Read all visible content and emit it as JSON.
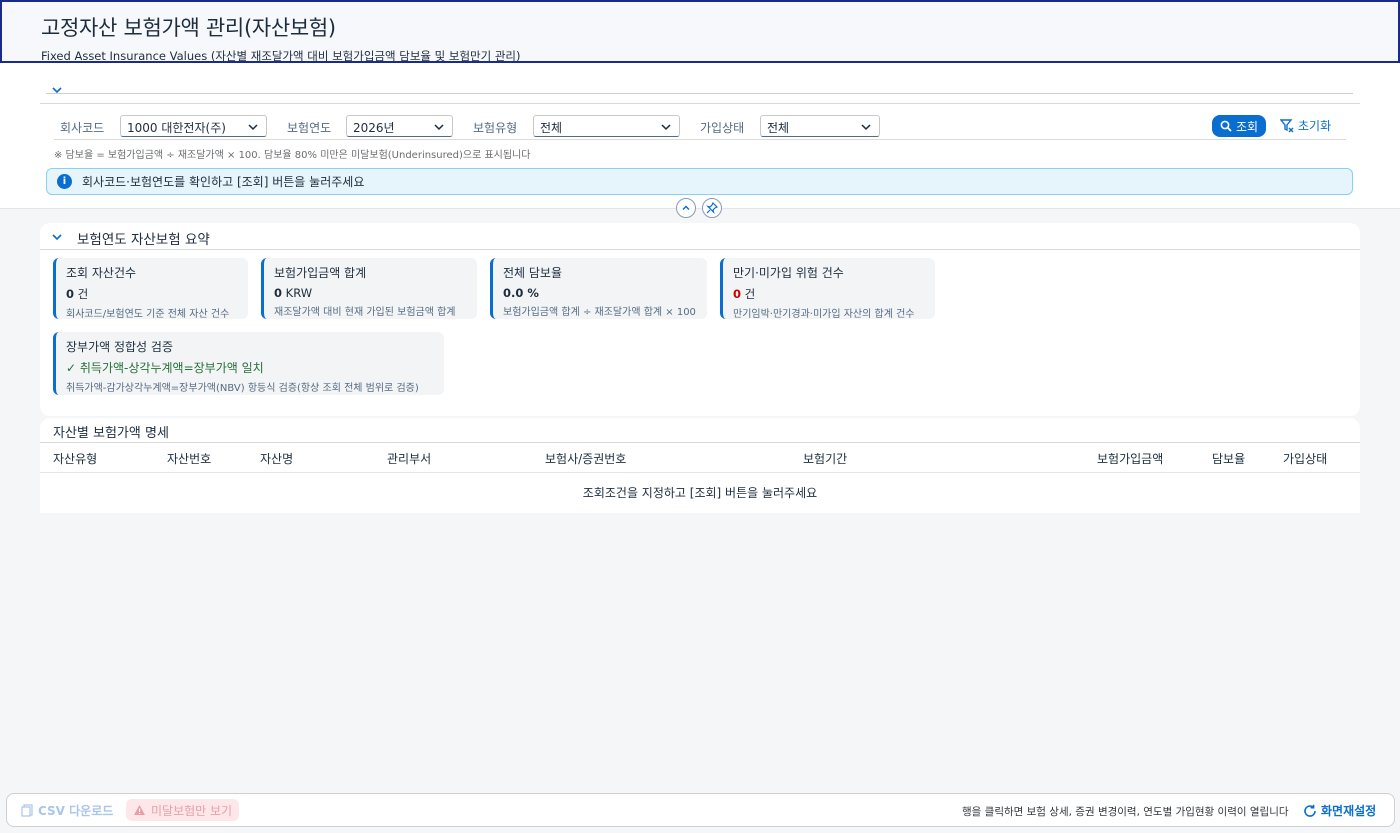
{
  "header": {
    "title": "고정자산 보험가액 관리(자산보험)",
    "subtitle": "Fixed Asset Insurance Values (자산별 재조달가액 대비 보험가입금액 담보율 및 보험만기 관리)"
  },
  "filters": {
    "company_label": "회사코드",
    "company_value": "1000 대한전자(주)",
    "year_label": "보험연도",
    "year_value": "2026년",
    "type_label": "보험유형",
    "type_value": "전체",
    "status_label": "가입상태",
    "status_value": "전체",
    "go_label": "조회",
    "reset_label": "초기화",
    "note": "※ 담보율 = 보험가입금액 ÷ 재조달가액 × 100. 담보율 80% 미만은 미달보험(Underinsured)으로 표시됩니다",
    "info": "회사코드·보험연도를 확인하고 [조회] 버튼을 눌러주세요"
  },
  "summary": {
    "title": "보험연도 자산보험 요약",
    "cards": [
      {
        "title": "조회 자산건수",
        "value": "0",
        "unit": "건",
        "desc": "회사코드/보험연도 기준 전체 자산 건수"
      },
      {
        "title": "보험가입금액 합계",
        "value": "0",
        "unit": "KRW",
        "desc": "재조달가액 대비 현재 가입된 보험금액 합계"
      },
      {
        "title": "전체 담보율",
        "value": "0.0 %",
        "unit": "",
        "desc": "보험가입금액 합계 ÷ 재조달가액 합계 × 100"
      },
      {
        "title": "만기·미가입 위험 건수",
        "value": "0",
        "unit": "건",
        "desc": "만기임박·만기경과·미가입 자산의 합계 건수"
      }
    ],
    "validation": {
      "title": "장부가액 정합성 검증",
      "status": "취득가액-상각누계액=장부가액 일치",
      "desc": "취득가액-감가상각누계액=장부가액(NBV) 항등식 검증(항상 조회 전체 범위로 검증)"
    }
  },
  "detail": {
    "title": "자산별 보험가액 명세",
    "columns": [
      "자산유형",
      "자산번호",
      "자산명",
      "관리부서",
      "보험사/증권번호",
      "보험기간",
      "보험가입금액",
      "담보율",
      "가입상태"
    ],
    "empty": "조회조건을 지정하고 [조회] 버튼을 눌러주세요"
  },
  "footer": {
    "csv_label": "CSV 다운로드",
    "underinsured_label": "미달보험만 보기",
    "hint": "행을 클릭하면 보험 상세, 증권 변경이력, 연도별 가입현황 이력이 열립니다",
    "refresh_label": "화면재설정"
  },
  "colors": {
    "accent": "#0a6ed1",
    "header_border": "#1a2b8f",
    "risk": "#cc0000",
    "ok": "#256f3a"
  }
}
